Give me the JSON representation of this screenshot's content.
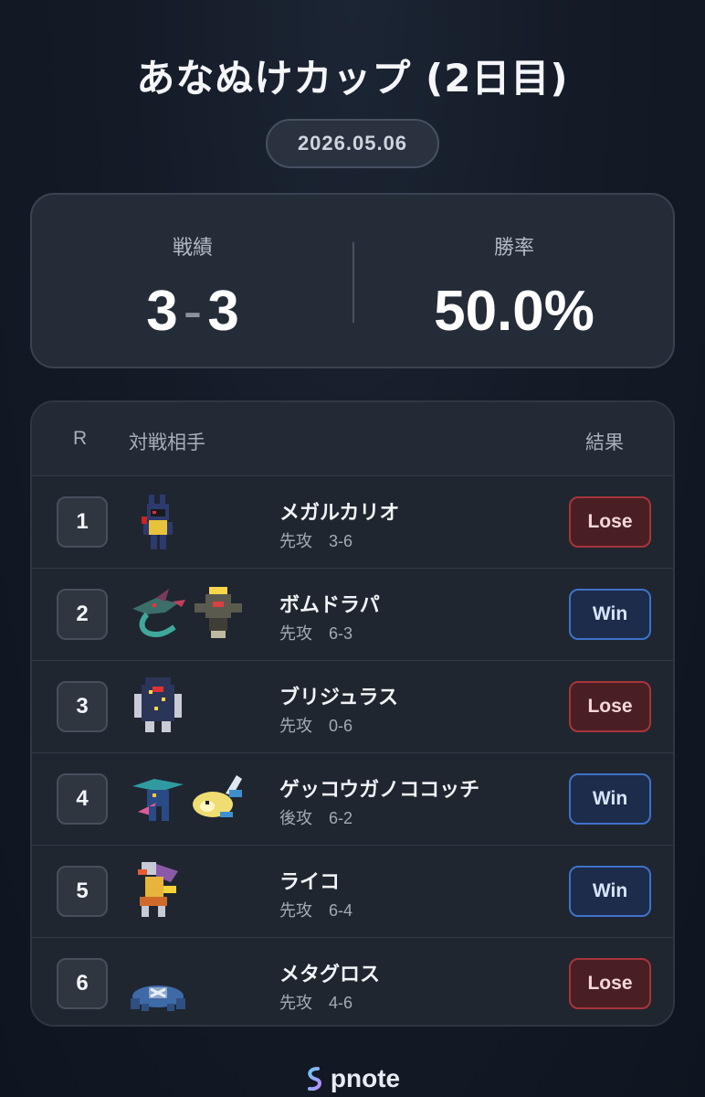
{
  "header": {
    "title": "あなぬけカップ (2日目)",
    "date": "2026.05.06"
  },
  "stats": {
    "record_label": "戦績",
    "wins": "3",
    "dash": "-",
    "losses": "3",
    "winrate_label": "勝率",
    "winrate": "50.0%"
  },
  "table": {
    "headers": {
      "round": "R",
      "opponent": "対戦相手",
      "result": "結果"
    },
    "rows": [
      {
        "round": "1",
        "name": "メガルカリオ",
        "order": "先攻",
        "score": "3-6",
        "result": "Lose",
        "sprites": [
          "mega-lucario-sprite"
        ]
      },
      {
        "round": "2",
        "name": "ボムドラパ",
        "order": "先攻",
        "score": "6-3",
        "result": "Win",
        "sprites": [
          "dragapult-sprite",
          "dusknoir-sprite"
        ]
      },
      {
        "round": "3",
        "name": "ブリジュラス",
        "order": "先攻",
        "score": "0-6",
        "result": "Lose",
        "sprites": [
          "archaludon-sprite"
        ]
      },
      {
        "round": "4",
        "name": "ゲッコウガノココッチ",
        "order": "後攻",
        "score": "6-2",
        "result": "Win",
        "sprites": [
          "greninja-sprite",
          "dudunsparce-sprite"
        ]
      },
      {
        "round": "5",
        "name": "ライコ",
        "order": "先攻",
        "score": "6-4",
        "result": "Win",
        "sprites": [
          "raging-bolt-sprite"
        ]
      },
      {
        "round": "6",
        "name": "メタグロス",
        "order": "先攻",
        "score": "4-6",
        "result": "Lose",
        "sprites": [
          "metagross-sprite"
        ]
      }
    ]
  },
  "footer": {
    "brand": "pnote"
  },
  "colors": {
    "lose_bg": "#4a1f24",
    "lose_border": "#a8343a",
    "win_bg": "#1d2c4a",
    "win_border": "#3f72c8"
  }
}
